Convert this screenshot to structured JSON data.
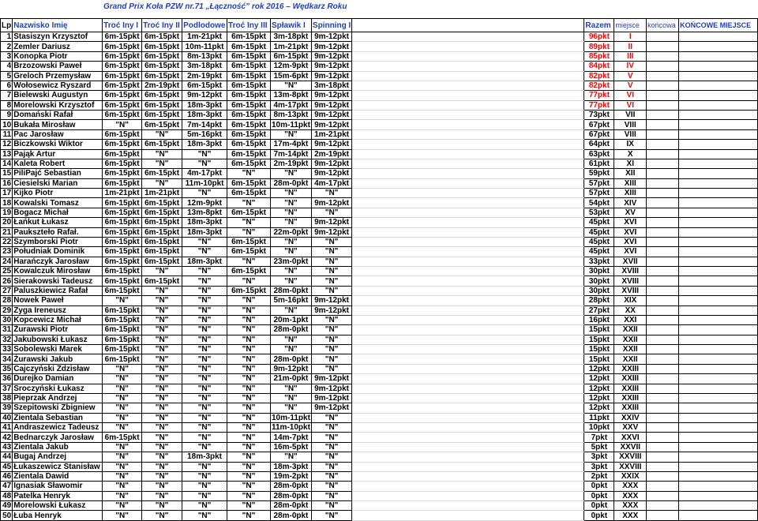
{
  "title": "Grand Prix Koła PZW nr.71 „Łączność” rok 2016 – Wędkarz Roku",
  "headers": {
    "lp": "Lp",
    "name": "Nazwisko Imię",
    "r1": "Troć Iny I",
    "r2": "Troć Iny II",
    "r3": "Podlodowe",
    "r4": "Troć Iny III",
    "r5": "Spławik I",
    "r6": "Spinning I",
    "total": "Razem",
    "place": "miejsce",
    "final": "końcowa",
    "final_place": "KOŃCOWE MIEJSCE"
  },
  "rows": [
    {
      "lp": "1",
      "name": "Stasiszyn Krzysztof",
      "r": [
        "6m-15pkt",
        "6m-15pkt",
        "1m-21pkt",
        "6m-15pkt",
        "3m-18pkt",
        "9m-12pkt"
      ],
      "total": "96pkt",
      "place": "I",
      "red": true
    },
    {
      "lp": "2",
      "name": "Zemler Dariusz",
      "r": [
        "6m-15pkt",
        "6m-15pkt",
        "10m-11pkt",
        "6m-15pkt",
        "1m-21pkt",
        "9m-12pkt"
      ],
      "total": "89pkt",
      "place": "II",
      "red": true
    },
    {
      "lp": "3",
      "name": "Konopka Piotr",
      "r": [
        "6m-15pkt",
        "6m-15pkt",
        "8m-13pkt",
        "6m-15pkt",
        "6m-15pkt",
        "9m-12pkt"
      ],
      "total": "85pkt",
      "place": "III",
      "red": true
    },
    {
      "lp": "4",
      "name": "Brzozowski Paweł",
      "r": [
        "6m-15pkt",
        "6m-15pkt",
        "3m-18pkt",
        "6m-15pkt",
        "12m-9pkt",
        "9m-12pkt"
      ],
      "total": "84pkt",
      "place": "IV",
      "red": true
    },
    {
      "lp": "5",
      "name": "Greloch Przemysław",
      "r": [
        "6m-15pkt",
        "6m-15pkt",
        "2m-19pkt",
        "6m-15pkt",
        "15m-6pkt",
        "9m-12pkt"
      ],
      "total": "82pkt",
      "place": "V",
      "red": true
    },
    {
      "lp": "6",
      "name": "Wołosewicz Ryszard",
      "r": [
        "6m-15pkt",
        "2m-19pkt",
        "6m-15pkt",
        "6m-15pkt",
        "\"N\"",
        "3m-18pkt"
      ],
      "total": "82pkt",
      "place": "V",
      "red": true
    },
    {
      "lp": "7",
      "name": "Bielewski Augustyn",
      "r": [
        "6m-15pkt",
        "6m-15pkt",
        "9m-12pkt",
        "6m-15pkt",
        "13m-8pkt",
        "9m-12pkt"
      ],
      "total": "77pkt",
      "place": "VI",
      "red": true
    },
    {
      "lp": "8",
      "name": "Morelowski Krzysztof",
      "r": [
        "6m-15pkt",
        "6m-15pkt",
        "18m-3pkt",
        "6m-15pkt",
        "4m-17pkt",
        "9m-12pkt"
      ],
      "total": "77pkt",
      "place": "VI",
      "red": true
    },
    {
      "lp": "9",
      "name": "Domański Rafał",
      "r": [
        "6m-15pkt",
        "6m-15pkt",
        "18m-3pkt",
        "6m-15pkt",
        "8m-13pkt",
        "9m-12pkt"
      ],
      "total": "73pkt",
      "place": "VII",
      "red": false
    },
    {
      "lp": "10",
      "name": "Bukała Mirosław",
      "r": [
        "\"N\"",
        "6m-15pkt",
        "7m-14pkt",
        "6m-15pkt",
        "10m-11pkt",
        "9m-12pkt"
      ],
      "total": "67pkt",
      "place": "VIII",
      "red": false
    },
    {
      "lp": "11",
      "name": "Pac Jarosław",
      "r": [
        "6m-15pkt",
        "\"N\"",
        "5m-16pkt",
        "6m-15pkt",
        "\"N\"",
        "1m-21pkt"
      ],
      "total": "67pkt",
      "place": "VIII",
      "red": false
    },
    {
      "lp": "12",
      "name": "Biczkowski Wiktor",
      "r": [
        "6m-15pkt",
        "6m-15pkt",
        "18m-3pkt",
        "6m-15pkt",
        "17m-4pkt",
        "9m-12pkt"
      ],
      "total": "64pkt",
      "place": "IX",
      "red": false
    },
    {
      "lp": "13",
      "name": "Pająk Artur",
      "r": [
        "6m-15pkt",
        "\"N\"",
        "\"N\"",
        "6m-15pkt",
        "7m-14pkt",
        "2m-19pkt"
      ],
      "total": "63pkt",
      "place": "X",
      "red": false
    },
    {
      "lp": "14",
      "name": "Kaleta Robert",
      "r": [
        "6m-15pkt",
        "\"N\"",
        "\"N\"",
        "6m-15pkt",
        "2m-19pkt",
        "9m-12pkt"
      ],
      "total": "61pkt",
      "place": "XI",
      "red": false
    },
    {
      "lp": "15",
      "name": "PiliPajć Sebastian",
      "r": [
        "6m-15pkt",
        "6m-15pkt",
        "4m-17pkt",
        "\"N\"",
        "\"N\"",
        "9m-12pkt"
      ],
      "total": "59pkt",
      "place": "XII",
      "red": false
    },
    {
      "lp": "16",
      "name": "Ciesielski Marian",
      "r": [
        "6m-15pkt",
        "\"N\"",
        "11m-10pkt",
        "6m-15pkt",
        "28m-0pkt",
        "4m-17pkt"
      ],
      "total": "57pkt",
      "place": "XIII",
      "red": false
    },
    {
      "lp": "17",
      "name": "Kijko Piotr",
      "r": [
        "1m-21pkt",
        "1m-21pkt",
        "\"N\"",
        "6m-15pkt",
        "\"N\"",
        "\"N\""
      ],
      "total": "57pkt",
      "place": "XIII",
      "red": false
    },
    {
      "lp": "18",
      "name": "Kowalski Tomasz",
      "r": [
        "6m-15pkt",
        "6m-15pkt",
        "12m-9pkt",
        "\"N\"",
        "\"N\"",
        "9m-12pkt"
      ],
      "total": "54pkt",
      "place": "XIV",
      "red": false
    },
    {
      "lp": "19",
      "name": "Bogacz Michał",
      "r": [
        "6m-15pkt",
        "6m-15pkt",
        "13m-8pkt",
        "6m-15pkt",
        "\"N\"",
        "\"N\""
      ],
      "total": "53pkt",
      "place": "XV",
      "red": false
    },
    {
      "lp": "20",
      "name": "Łańkut Łukasz",
      "r": [
        "6m-15pkt",
        "6m-15pkt",
        "18m-3pkt",
        "\"N\"",
        "\"N\"",
        "9m-12pkt"
      ],
      "total": "45pkt",
      "place": "XVI",
      "red": false
    },
    {
      "lp": "21",
      "name": "Paukszteło Rafał.",
      "r": [
        "6m-15pkt",
        "6m-15pkt",
        "18m-3pkt",
        "\"N\"",
        "22m-0pkt",
        "9m-12pkt"
      ],
      "total": "45pkt",
      "place": "XVI",
      "red": false
    },
    {
      "lp": "22",
      "name": "Szymborski Piotr",
      "r": [
        "6m-15pkt",
        "6m-15pkt",
        "\"N\"",
        "6m-15pkt",
        "\"N\"",
        "\"N\""
      ],
      "total": "45pkt",
      "place": "XVI",
      "red": false
    },
    {
      "lp": "23",
      "name": "Południak Dominik",
      "r": [
        "6m-15pkt",
        "6m-15pkt",
        "\"N\"",
        "6m-15pkt",
        "\"N\"",
        "\"N\""
      ],
      "total": "45pkt",
      "place": "XVI",
      "red": false
    },
    {
      "lp": "24",
      "name": "Harańczyk Jarosław",
      "r": [
        "6m-15pkt",
        "6m-15pkt",
        "18m-3pkt",
        "\"N\"",
        "23m-0pkt",
        "\"N\""
      ],
      "total": "33pkt",
      "place": "XVII",
      "red": false
    },
    {
      "lp": "25",
      "name": "Kowalczuk Mirosław",
      "r": [
        "6m-15pkt",
        "\"N\"",
        "\"N\"",
        "6m-15pkt",
        "\"N\"",
        "\"N\""
      ],
      "total": "30pkt",
      "place": "XVIII",
      "red": false
    },
    {
      "lp": "26",
      "name": "Sierakowski Tadeusz",
      "r": [
        "6m-15pkt",
        "6m-15pkt",
        "\"N\"",
        "\"N\"",
        "\"N\"",
        "\"N\""
      ],
      "total": "30pkt",
      "place": "XVIII",
      "red": false
    },
    {
      "lp": "27",
      "name": "Paluszkiewicz Rafał",
      "r": [
        "6m-15pkt",
        "\"N\"",
        "\"N\"",
        "6m-15pkt",
        "28m-0pkt",
        "\"N\""
      ],
      "total": "30pkt",
      "place": "XVIII",
      "red": false
    },
    {
      "lp": "28",
      "name": "Nowek Paweł",
      "r": [
        "\"N\"",
        "\"N\"",
        "\"N\"",
        "\"N\"",
        "5m-16pkt",
        "9m-12pkt"
      ],
      "total": "28pkt",
      "place": "XIX",
      "red": false
    },
    {
      "lp": "29",
      "name": "Zyga Ireneusz",
      "r": [
        "6m-15pkt",
        "\"N\"",
        "\"N\"",
        "\"N\"",
        "\"N\"",
        "9m-12pkt"
      ],
      "total": "27pkt",
      "place": "XX",
      "red": false
    },
    {
      "lp": "30",
      "name": "Kopcewicz Michał",
      "r": [
        "6m-15pkt",
        "\"N\"",
        "\"N\"",
        "\"N\"",
        "20m-1pkt",
        "\"N\""
      ],
      "total": "16pkt",
      "place": "XXI",
      "red": false
    },
    {
      "lp": "31",
      "name": "Żurawski Piotr",
      "r": [
        "6m-15pkt",
        "\"N\"",
        "\"N\"",
        "\"N\"",
        "28m-0pkt",
        "\"N\""
      ],
      "total": "15pkt",
      "place": "XXII",
      "red": false
    },
    {
      "lp": "32",
      "name": "Jakubowski Łukasz",
      "r": [
        "6m-15pkt",
        "\"N\"",
        "\"N\"",
        "\"N\"",
        "\"N\"",
        "\"N\""
      ],
      "total": "15pkt",
      "place": "XXII",
      "red": false
    },
    {
      "lp": "33",
      "name": "Sobolewski Marek",
      "r": [
        "6m-15pkt",
        "\"N\"",
        "\"N\"",
        "\"N\"",
        "\"N\"",
        "\"N\""
      ],
      "total": "15pkt",
      "place": "XXII",
      "red": false
    },
    {
      "lp": "34",
      "name": "Żurawski Jakub",
      "r": [
        "6m-15pkt",
        "\"N\"",
        "\"N\"",
        "\"N\"",
        "28m-0pkt",
        "\"N\""
      ],
      "total": "15pkt",
      "place": "XXII",
      "red": false
    },
    {
      "lp": "35",
      "name": "Cajczyński Zdzisław",
      "r": [
        "\"N\"",
        "\"N\"",
        "\"N\"",
        "\"N\"",
        "9m-12pkt",
        "\"N\""
      ],
      "total": "12pkt",
      "place": "XXIII",
      "red": false
    },
    {
      "lp": "36",
      "name": "Durejko Damian",
      "r": [
        "\"N\"",
        "\"N\"",
        "\"N\"",
        "\"N\"",
        "21m-0pkt",
        "9m-12pkt"
      ],
      "total": "12pkt",
      "place": "XXIII",
      "red": false
    },
    {
      "lp": "37",
      "name": "Sroczyński Łukasz",
      "r": [
        "\"N\"",
        "\"N\"",
        "\"N\"",
        "\"N\"",
        "\"N\"",
        "9m-12pkt"
      ],
      "total": "12pkt",
      "place": "XXIII",
      "red": false
    },
    {
      "lp": "38",
      "name": "Pieprzak Andrzej",
      "r": [
        "\"N\"",
        "\"N\"",
        "\"N\"",
        "\"N\"",
        "\"N\"",
        "9m-12pkt"
      ],
      "total": "12pkt",
      "place": "XXIII",
      "red": false
    },
    {
      "lp": "39",
      "name": "Szepitowski Zbigniew",
      "r": [
        "\"N\"",
        "\"N\"",
        "\"N\"",
        "\"N\"",
        "\"N\"",
        "9m-12pkt"
      ],
      "total": "12pkt",
      "place": "XXIII",
      "red": false
    },
    {
      "lp": "40",
      "name": "Zientala Sebastian",
      "r": [
        "\"N\"",
        "\"N\"",
        "\"N\"",
        "\"N\"",
        "10m-11pkt",
        "\"N\""
      ],
      "total": "11pkt",
      "place": "XXIV",
      "red": false
    },
    {
      "lp": "41",
      "name": "Andraszewicz Tadeusz",
      "r": [
        "\"N\"",
        "\"N\"",
        "\"N\"",
        "\"N\"",
        "11m-10pkt",
        "\"N\""
      ],
      "total": "10pkt",
      "place": "XXV",
      "red": false
    },
    {
      "lp": "42",
      "name": "Bednarczyk Jarosław",
      "r": [
        "6m-15pkt",
        "\"N\"",
        "\"N\"",
        "\"N\"",
        "14m-7pkt",
        "\"N\""
      ],
      "total": "7pkt",
      "place": "XXVI",
      "red": false
    },
    {
      "lp": "43",
      "name": "Zientala Jakub",
      "r": [
        "\"N\"",
        "\"N\"",
        "\"N\"",
        "\"N\"",
        "16m-5pkt",
        "\"N\""
      ],
      "total": "5pkt",
      "place": "XXVII",
      "red": false
    },
    {
      "lp": "44",
      "name": "Bugaj Andrzej",
      "r": [
        "\"N\"",
        "\"N\"",
        "18m-3pkt",
        "\"N\"",
        "\"N\"",
        "\"N\""
      ],
      "total": "3pkt",
      "place": "XXVIII",
      "red": false
    },
    {
      "lp": "45",
      "name": "Łukaszewicz Stanisław",
      "r": [
        "\"N\"",
        "\"N\"",
        "\"N\"",
        "\"N\"",
        "18m-3pkt",
        "\"N\""
      ],
      "total": "3pkt",
      "place": "XXVIII",
      "red": false
    },
    {
      "lp": "46",
      "name": "Zientala Dawid",
      "r": [
        "\"N\"",
        "\"N\"",
        "\"N\"",
        "\"N\"",
        "19m-2pkt",
        "\"N\""
      ],
      "total": "2pkt",
      "place": "XXIX",
      "red": false
    },
    {
      "lp": "47",
      "name": "Ignasiak Sławomir",
      "r": [
        "\"N\"",
        "\"N\"",
        "\"N\"",
        "\"N\"",
        "28m-0pkt",
        "\"N\""
      ],
      "total": "0pkt",
      "place": "XXX",
      "red": false
    },
    {
      "lp": "48",
      "name": "Patelka Henryk",
      "r": [
        "\"N\"",
        "\"N\"",
        "\"N\"",
        "\"N\"",
        "28m-0pkt",
        "\"N\""
      ],
      "total": "0pkt",
      "place": "XXX",
      "red": false
    },
    {
      "lp": "49",
      "name": "Morelowski Łukasz",
      "r": [
        "\"N\"",
        "\"N\"",
        "\"N\"",
        "\"N\"",
        "28m-0pkt",
        "\"N\""
      ],
      "total": "0pkt",
      "place": "XXX",
      "red": false
    },
    {
      "lp": "50",
      "name": "Łuba Henryk",
      "r": [
        "\"N\"",
        "\"N\"",
        "\"N\"",
        "\"N\"",
        "28m-0pkt",
        "\"N\""
      ],
      "total": "0pkt",
      "place": "XXX",
      "red": false
    }
  ],
  "colors": {
    "header_blue": "#1f3fbf",
    "top_place_red": "#ff0000"
  }
}
